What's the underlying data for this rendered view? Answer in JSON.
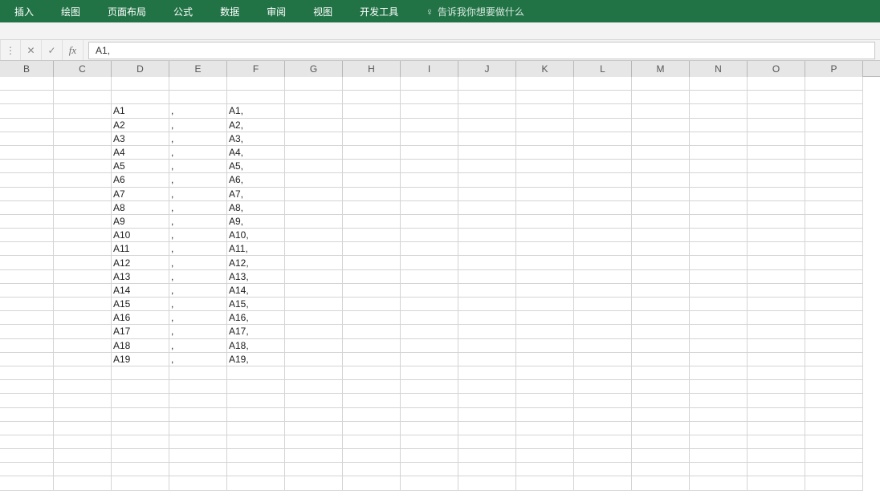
{
  "ribbon": {
    "tabs": [
      "插入",
      "绘图",
      "页面布局",
      "公式",
      "数据",
      "审阅",
      "视图",
      "开发工具"
    ],
    "tell_me": "告诉我你想要做什么"
  },
  "formula_bar": {
    "cancel": "✕",
    "confirm": "✓",
    "fx": "fx",
    "dots": "⋮",
    "value": "A1,"
  },
  "columns": [
    "B",
    "C",
    "D",
    "E",
    "F",
    "G",
    "H",
    "I",
    "J",
    "K",
    "L",
    "M",
    "N",
    "O",
    "P"
  ],
  "rows_count": 30,
  "blank_rows_before": 2,
  "data_rows": [
    {
      "D": "A1",
      "E": ",",
      "F": "A1,"
    },
    {
      "D": "A2",
      "E": ",",
      "F": "A2,"
    },
    {
      "D": "A3",
      "E": ",",
      "F": "A3,"
    },
    {
      "D": "A4",
      "E": ",",
      "F": "A4,"
    },
    {
      "D": "A5",
      "E": ",",
      "F": "A5,"
    },
    {
      "D": "A6",
      "E": ",",
      "F": "A6,"
    },
    {
      "D": "A7",
      "E": ",",
      "F": "A7,"
    },
    {
      "D": "A8",
      "E": ",",
      "F": "A8,"
    },
    {
      "D": "A9",
      "E": ",",
      "F": "A9,"
    },
    {
      "D": "A10",
      "E": ",",
      "F": "A10,"
    },
    {
      "D": "A11",
      "E": ",",
      "F": "A11,"
    },
    {
      "D": "A12",
      "E": ",",
      "F": "A12,"
    },
    {
      "D": "A13",
      "E": ",",
      "F": "A13,"
    },
    {
      "D": "A14",
      "E": ",",
      "F": "A14,"
    },
    {
      "D": "A15",
      "E": ",",
      "F": "A15,"
    },
    {
      "D": "A16",
      "E": ",",
      "F": "A16,"
    },
    {
      "D": "A17",
      "E": ",",
      "F": "A17,"
    },
    {
      "D": "A18",
      "E": ",",
      "F": "A18,"
    },
    {
      "D": "A19",
      "E": ",",
      "F": "A19,"
    }
  ]
}
